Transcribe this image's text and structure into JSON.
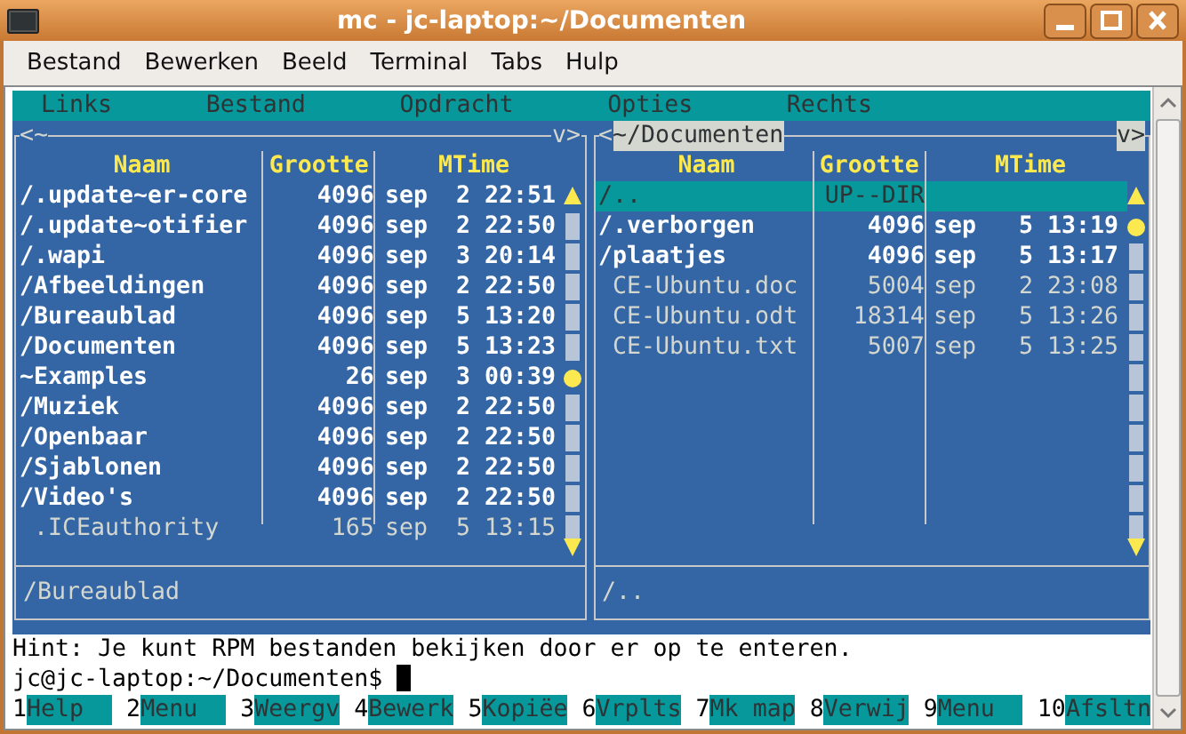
{
  "window": {
    "title": "mc - jc-laptop:~/Documenten"
  },
  "menubar": [
    "Bestand",
    "Bewerken",
    "Beeld",
    "Terminal",
    "Tabs",
    "Hulp"
  ],
  "mc_menu": [
    "Links",
    "Bestand",
    "Opdracht",
    "Opties",
    "Rechts"
  ],
  "panels": [
    {
      "title_left": "<",
      "path": "~",
      "path_highlighted": false,
      "title_right": "v>",
      "columns": [
        "Naam",
        "Grootte",
        "MTime"
      ],
      "mini_status": "/Bureaublad",
      "rows": [
        {
          "name": "/.update~er-core",
          "size": "4096",
          "mtime": "sep  2 22:51",
          "kind": "dir",
          "selected": false
        },
        {
          "name": "/.update~otifier",
          "size": "4096",
          "mtime": "sep  2 22:50",
          "kind": "dir",
          "selected": false
        },
        {
          "name": "/.wapi",
          "size": "4096",
          "mtime": "sep  3 20:14",
          "kind": "dir",
          "selected": false
        },
        {
          "name": "/Afbeeldingen",
          "size": "4096",
          "mtime": "sep  2 22:50",
          "kind": "dir",
          "selected": false
        },
        {
          "name": "/Bureaublad",
          "size": "4096",
          "mtime": "sep  5 13:20",
          "kind": "dir",
          "selected": false
        },
        {
          "name": "/Documenten",
          "size": "4096",
          "mtime": "sep  5 13:23",
          "kind": "dir",
          "selected": false
        },
        {
          "name": "~Examples",
          "size": "26",
          "mtime": "sep  3 00:39",
          "kind": "dir",
          "selected": false
        },
        {
          "name": "/Muziek",
          "size": "4096",
          "mtime": "sep  2 22:50",
          "kind": "dir",
          "selected": false
        },
        {
          "name": "/Openbaar",
          "size": "4096",
          "mtime": "sep  2 22:50",
          "kind": "dir",
          "selected": false
        },
        {
          "name": "/Sjablonen",
          "size": "4096",
          "mtime": "sep  2 22:50",
          "kind": "dir",
          "selected": false
        },
        {
          "name": "/Video's",
          "size": "4096",
          "mtime": "sep  2 22:50",
          "kind": "dir",
          "selected": false
        },
        {
          "name": " .ICEauthority",
          "size": "165",
          "mtime": "sep  5 13:15",
          "kind": "file",
          "selected": false
        }
      ]
    },
    {
      "title_left": "<",
      "path": "~/Documenten",
      "path_highlighted": true,
      "title_right": "v>",
      "columns": [
        "Naam",
        "Grootte",
        "MTime"
      ],
      "mini_status": "/..",
      "rows": [
        {
          "name": "/..",
          "size": "UP--DIR",
          "mtime": "",
          "kind": "updir",
          "selected": true
        },
        {
          "name": "/.verborgen",
          "size": "4096",
          "mtime": "sep   5 13:19",
          "kind": "dir",
          "selected": false
        },
        {
          "name": "/plaatjes",
          "size": "4096",
          "mtime": "sep   5 13:17",
          "kind": "dir",
          "selected": false
        },
        {
          "name": " CE-Ubuntu.doc",
          "size": "5004",
          "mtime": "sep   2 23:08",
          "kind": "file",
          "selected": false
        },
        {
          "name": " CE-Ubuntu.odt",
          "size": "18314",
          "mtime": "sep   5 13:26",
          "kind": "file",
          "selected": false
        },
        {
          "name": " CE-Ubuntu.txt",
          "size": "5007",
          "mtime": "sep   5 13:25",
          "kind": "file",
          "selected": false
        }
      ]
    }
  ],
  "hint": "Hint: Je kunt RPM bestanden bekijken door er op te enteren.",
  "prompt": "jc@jc-laptop:~/Documenten$",
  "function_keys": [
    {
      "number": "1",
      "label": "Help"
    },
    {
      "number": "2",
      "label": "Menu"
    },
    {
      "number": "3",
      "label": "Weergv"
    },
    {
      "number": "4",
      "label": "Bewerk"
    },
    {
      "number": "5",
      "label": "Kopiëe"
    },
    {
      "number": "6",
      "label": "Vrplts"
    },
    {
      "number": "7",
      "label": "Mk map"
    },
    {
      "number": "8",
      "label": "Verwij"
    },
    {
      "number": "9",
      "label": "Menu"
    },
    {
      "number": "10",
      "label": "Afsltn"
    }
  ]
}
